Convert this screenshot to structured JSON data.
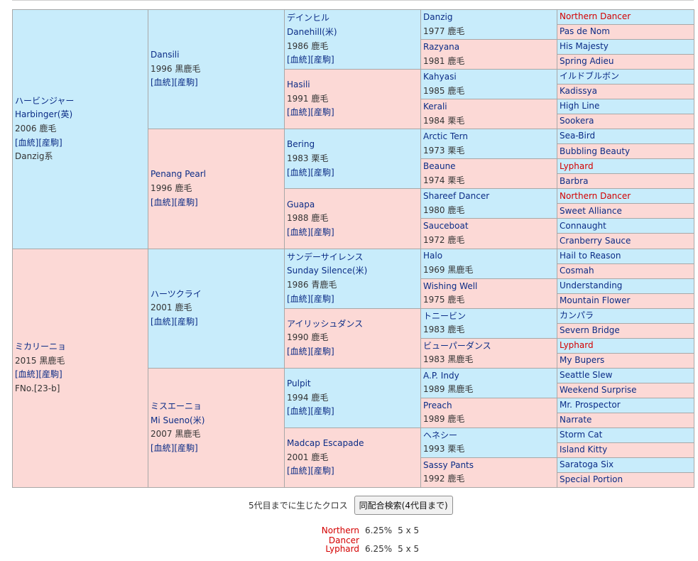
{
  "pedigree": {
    "g1": [
      {
        "name": "ハービンジャー",
        "alt": "Harbinger(英)",
        "info": "2006 鹿毛",
        "links": "[血統][産駒]",
        "extra": "Danzig系",
        "sex": "m"
      },
      {
        "name": "ミカリーニョ",
        "alt": "",
        "info": "2015 黒鹿毛",
        "links": "[血統][産駒]",
        "extra": "FNo.[23-b]",
        "sex": "f"
      }
    ],
    "g2": [
      {
        "name": "Dansili",
        "alt": "",
        "info": "1996 黒鹿毛",
        "links": "[血統][産駒]",
        "sex": "m"
      },
      {
        "name": "Penang Pearl",
        "alt": "",
        "info": "1996 鹿毛",
        "links": "[血統][産駒]",
        "sex": "f"
      },
      {
        "name": "ハーツクライ",
        "alt": "",
        "info": "2001 鹿毛",
        "links": "[血統][産駒]",
        "sex": "m"
      },
      {
        "name": "ミスエーニョ",
        "alt": "Mi Sueno(米)",
        "info": "2007 黒鹿毛",
        "links": "[血統][産駒]",
        "sex": "f"
      }
    ],
    "g3": [
      {
        "name": "デインヒル",
        "alt": "Danehill(米)",
        "info": "1986 鹿毛",
        "links": "[血統][産駒]",
        "sex": "m"
      },
      {
        "name": "Hasili",
        "alt": "",
        "info": "1991 鹿毛",
        "links": "[血統][産駒]",
        "sex": "f"
      },
      {
        "name": "Bering",
        "alt": "",
        "info": "1983 栗毛",
        "links": "[血統][産駒]",
        "sex": "m"
      },
      {
        "name": "Guapa",
        "alt": "",
        "info": "1988 鹿毛",
        "links": "[血統][産駒]",
        "sex": "f"
      },
      {
        "name": "サンデーサイレンス",
        "alt": "Sunday Silence(米)",
        "info": "1986 青鹿毛",
        "links": "[血統][産駒]",
        "sex": "m"
      },
      {
        "name": "アイリッシュダンス",
        "alt": "",
        "info": "1990 鹿毛",
        "links": "[血統][産駒]",
        "sex": "f"
      },
      {
        "name": "Pulpit",
        "alt": "",
        "info": "1994 鹿毛",
        "links": "[血統][産駒]",
        "sex": "m"
      },
      {
        "name": "Madcap Escapade",
        "alt": "",
        "info": "2001 鹿毛",
        "links": "[血統][産駒]",
        "sex": "f"
      }
    ],
    "g4": [
      {
        "name": "Danzig",
        "info": "1977 鹿毛",
        "sex": "m"
      },
      {
        "name": "Razyana",
        "info": "1981 鹿毛",
        "sex": "f"
      },
      {
        "name": "Kahyasi",
        "info": "1985 鹿毛",
        "sex": "m"
      },
      {
        "name": "Kerali",
        "info": "1984 栗毛",
        "sex": "f"
      },
      {
        "name": "Arctic Tern",
        "info": "1973 栗毛",
        "sex": "m"
      },
      {
        "name": "Beaune",
        "info": "1974 栗毛",
        "sex": "f"
      },
      {
        "name": "Shareef Dancer",
        "info": "1980 鹿毛",
        "sex": "m"
      },
      {
        "name": "Sauceboat",
        "info": "1972 鹿毛",
        "sex": "f"
      },
      {
        "name": "Halo",
        "info": "1969 黒鹿毛",
        "sex": "m"
      },
      {
        "name": "Wishing Well",
        "info": "1975 鹿毛",
        "sex": "f"
      },
      {
        "name": "トニービン",
        "info": "1983 鹿毛",
        "sex": "m"
      },
      {
        "name": "ビューパーダンス",
        "info": "1983 黒鹿毛",
        "sex": "f"
      },
      {
        "name": "A.P. Indy",
        "info": "1989 黒鹿毛",
        "sex": "m"
      },
      {
        "name": "Preach",
        "info": "1989 鹿毛",
        "sex": "f"
      },
      {
        "name": "ヘネシー",
        "info": "1993 栗毛",
        "sex": "m"
      },
      {
        "name": "Sassy Pants",
        "info": "1992 鹿毛",
        "sex": "f"
      }
    ],
    "g5": [
      {
        "name": "Northern Dancer",
        "sex": "m",
        "cross": true
      },
      {
        "name": "Pas de Nom",
        "sex": "f"
      },
      {
        "name": "His Majesty",
        "sex": "m"
      },
      {
        "name": "Spring Adieu",
        "sex": "f"
      },
      {
        "name": "イルドブルボン",
        "sex": "m"
      },
      {
        "name": "Kadissya",
        "sex": "f"
      },
      {
        "name": "High Line",
        "sex": "m"
      },
      {
        "name": "Sookera",
        "sex": "f"
      },
      {
        "name": "Sea-Bird",
        "sex": "m"
      },
      {
        "name": "Bubbling Beauty",
        "sex": "f"
      },
      {
        "name": "Lyphard",
        "sex": "m",
        "cross": true
      },
      {
        "name": "Barbra",
        "sex": "f"
      },
      {
        "name": "Northern Dancer",
        "sex": "m",
        "cross": true
      },
      {
        "name": "Sweet Alliance",
        "sex": "f"
      },
      {
        "name": "Connaught",
        "sex": "m"
      },
      {
        "name": "Cranberry Sauce",
        "sex": "f"
      },
      {
        "name": "Hail to Reason",
        "sex": "m"
      },
      {
        "name": "Cosmah",
        "sex": "f"
      },
      {
        "name": "Understanding",
        "sex": "m"
      },
      {
        "name": "Mountain Flower",
        "sex": "f"
      },
      {
        "name": "カンパラ",
        "sex": "m"
      },
      {
        "name": "Severn Bridge",
        "sex": "f"
      },
      {
        "name": "Lyphard",
        "sex": "m",
        "cross": true
      },
      {
        "name": "My Bupers",
        "sex": "f"
      },
      {
        "name": "Seattle Slew",
        "sex": "m"
      },
      {
        "name": "Weekend Surprise",
        "sex": "f"
      },
      {
        "name": "Mr. Prospector",
        "sex": "m"
      },
      {
        "name": "Narrate",
        "sex": "f"
      },
      {
        "name": "Storm Cat",
        "sex": "m"
      },
      {
        "name": "Island Kitty",
        "sex": "f"
      },
      {
        "name": "Saratoga Six",
        "sex": "m"
      },
      {
        "name": "Special Portion",
        "sex": "f"
      }
    ]
  },
  "cross": {
    "title": "5代目までに生じたクロス",
    "button_label": "同配合検索(4代目まで)",
    "rows": [
      {
        "name": "Northern Dancer",
        "percent": "6.25%",
        "gen": "5 x 5"
      },
      {
        "name": "Lyphard",
        "percent": "6.25%",
        "gen": "5 x 5"
      }
    ]
  },
  "colors": {
    "male_bg": "#c8ecfb",
    "female_bg": "#fcd9d6",
    "link": "#0b2c86",
    "cross": "#d40000"
  }
}
